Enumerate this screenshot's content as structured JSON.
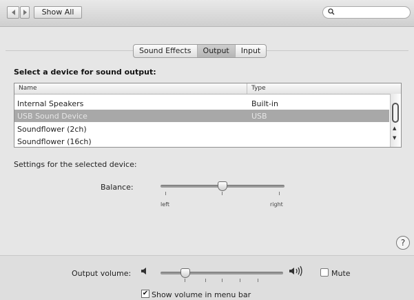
{
  "toolbar": {
    "back_icon": "back-arrow-icon",
    "forward_icon": "forward-arrow-icon",
    "show_all_label": "Show All",
    "search_icon": "search-icon",
    "search_value": ""
  },
  "tabs": [
    {
      "label": "Sound Effects",
      "selected": false
    },
    {
      "label": "Output",
      "selected": true
    },
    {
      "label": "Input",
      "selected": false
    }
  ],
  "output": {
    "heading": "Select a device for sound output:",
    "columns": {
      "name": "Name",
      "type": "Type"
    },
    "devices": [
      {
        "name": "Internal Speakers",
        "type": "Built-in",
        "selected": false
      },
      {
        "name": "USB Sound Device",
        "type": "USB",
        "selected": true
      },
      {
        "name": "Soundflower (2ch)",
        "type": "",
        "selected": false
      },
      {
        "name": "Soundflower (16ch)",
        "type": "",
        "selected": false
      }
    ],
    "settings_label": "Settings for the selected device:",
    "balance": {
      "label": "Balance:",
      "left_label": "left",
      "right_label": "right",
      "value": 0.5
    }
  },
  "help_label": "?",
  "footer": {
    "output_volume_label": "Output volume:",
    "volume_low_icon": "speaker-low-icon",
    "volume_high_icon": "speaker-high-icon",
    "output_volume_value": 0.2,
    "mute_label": "Mute",
    "mute_checked": false,
    "show_volume_label": "Show volume in menu bar",
    "show_volume_checked": true
  },
  "colors": {
    "selection": "#a8a8a8",
    "background": "#e6e6e6"
  }
}
